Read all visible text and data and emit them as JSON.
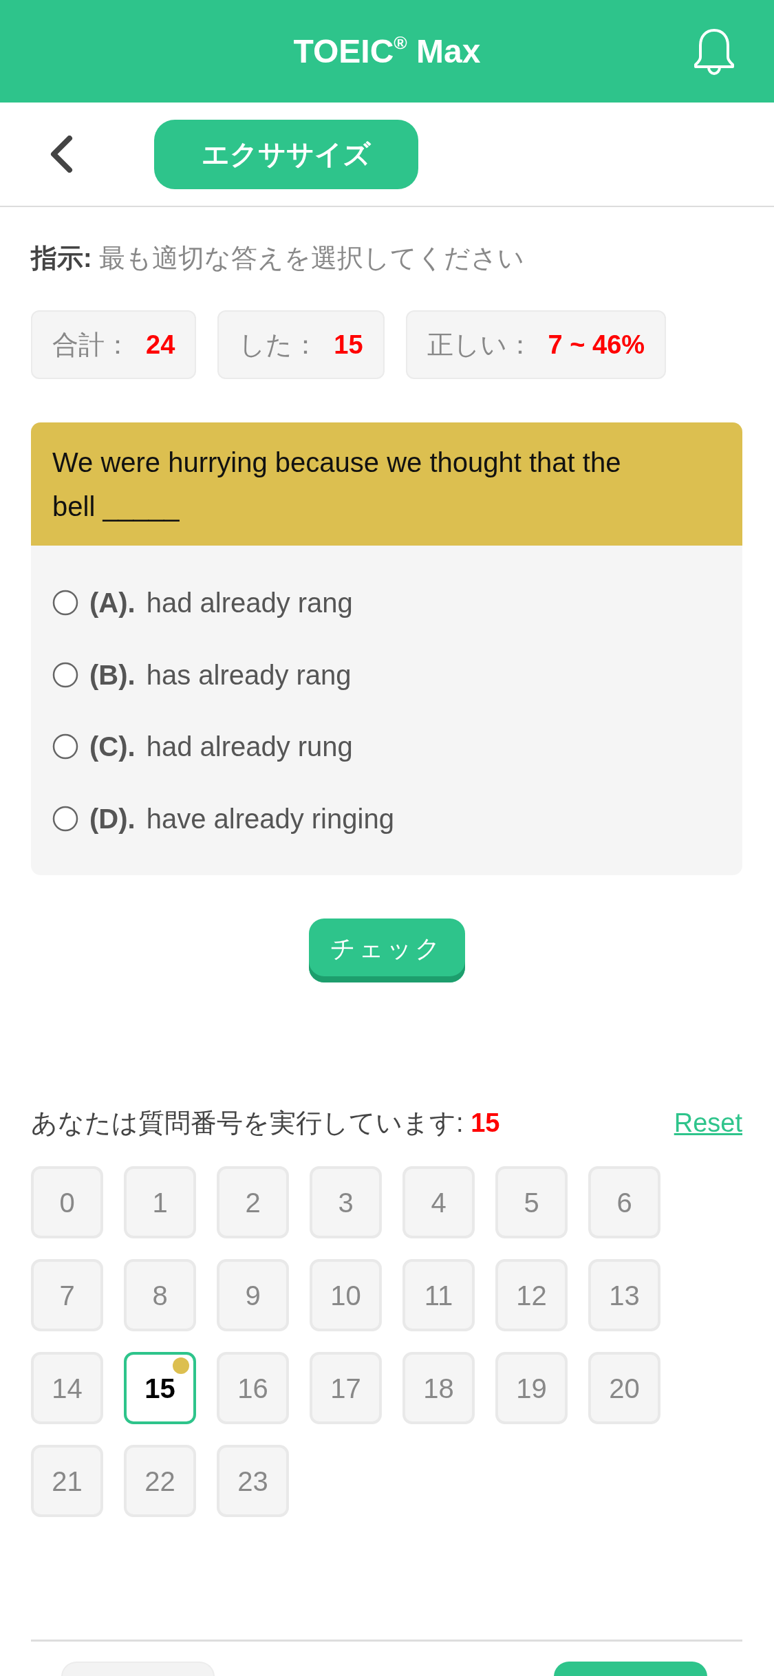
{
  "header": {
    "title": "TOEIC$^{®}$ Max"
  },
  "nav": {
    "tabs": [
      {
        "label": "エクササイズ",
        "selected": true
      }
    ]
  },
  "instruction": "**指示:** 最も適切な答えを選択してください",
  "stats": [
    {
      "label": "合計：",
      "value": "24"
    },
    {
      "label": "した：",
      "value": "15"
    },
    {
      "label": "正しい：",
      "value": "7 ~ 46%"
    }
  ],
  "question": {
    "text": "We were hurrying because we thought that the bell _____",
    "options": [
      {
        "letter": "(A).",
        "text": "had already rang",
        "selected": false
      },
      {
        "letter": "(B).",
        "text": "has already rang",
        "selected": false
      },
      {
        "letter": "(C).",
        "text": "had already rung",
        "selected": false
      },
      {
        "letter": "(D).",
        "text": "have already ringing",
        "selected": false
      }
    ]
  },
  "check_button": {
    "label": "チェック"
  },
  "progress": {
    "text": "あなたは質問番号を実行しています: **15**",
    "reset": "Reset"
  },
  "question_grid": [
    {
      "number": "0",
      "selected": false,
      "marked": false
    },
    {
      "number": "1",
      "selected": false,
      "marked": false
    },
    {
      "number": "2",
      "selected": false,
      "marked": false
    },
    {
      "number": "3",
      "selected": false,
      "marked": false
    },
    {
      "number": "4",
      "selected": false,
      "marked": false
    },
    {
      "number": "5",
      "selected": false,
      "marked": false
    },
    {
      "number": "6",
      "selected": false,
      "marked": false
    },
    {
      "number": "7",
      "selected": false,
      "marked": false
    },
    {
      "number": "8",
      "selected": false,
      "marked": false
    },
    {
      "number": "9",
      "selected": false,
      "marked": false
    },
    {
      "number": "10",
      "selected": false,
      "marked": false
    },
    {
      "number": "11",
      "selected": false,
      "marked": false
    },
    {
      "number": "12",
      "selected": false,
      "marked": false
    },
    {
      "number": "13",
      "selected": false,
      "marked": false
    },
    {
      "number": "14",
      "selected": false,
      "marked": false
    },
    {
      "number": "15",
      "selected": true,
      "marked": true
    },
    {
      "number": "16",
      "selected": false,
      "marked": false
    },
    {
      "number": "17",
      "selected": false,
      "marked": false
    },
    {
      "number": "18",
      "selected": false,
      "marked": false
    },
    {
      "number": "19",
      "selected": false,
      "marked": false
    },
    {
      "number": "20",
      "selected": false,
      "marked": false
    },
    {
      "number": "21",
      "selected": false,
      "marked": false
    },
    {
      "number": "22",
      "selected": false,
      "marked": false
    },
    {
      "number": "23",
      "selected": false,
      "marked": false
    }
  ],
  "footer": {
    "buttons": [
      {
        "kind": "secondary"
      },
      {
        "kind": "primary"
      }
    ]
  }
}
